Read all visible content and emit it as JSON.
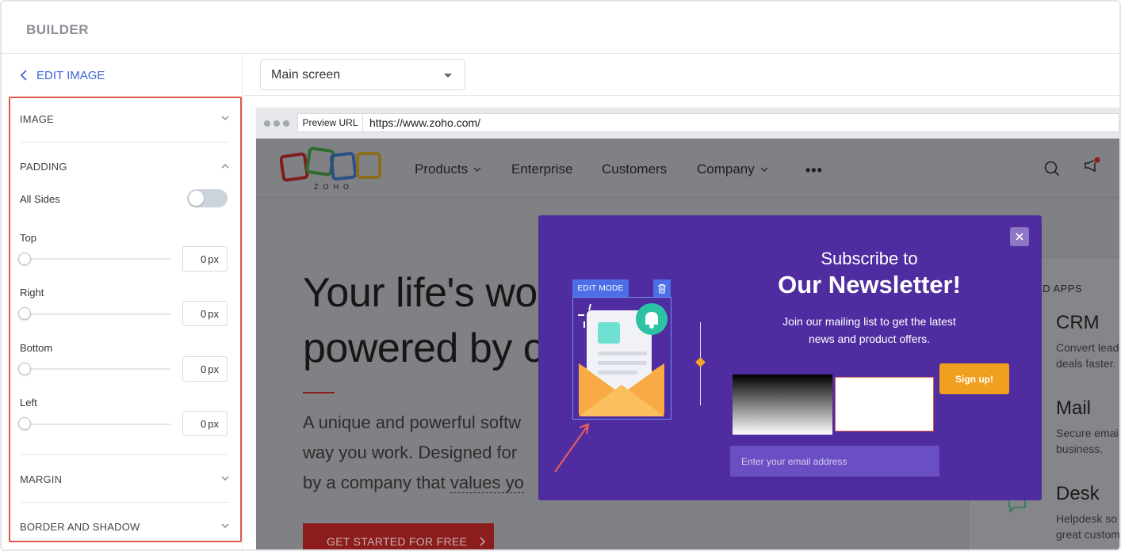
{
  "header": {
    "title": "BUILDER"
  },
  "sidebar": {
    "back_label": "EDIT IMAGE",
    "sections": {
      "image": "IMAGE",
      "padding": "PADDING",
      "margin": "MARGIN",
      "border_shadow": "BORDER AND SHADOW"
    },
    "padding": {
      "all_sides_label": "All Sides",
      "all_sides_on": false,
      "fields": [
        {
          "label": "Top",
          "value": "0",
          "unit": "px"
        },
        {
          "label": "Right",
          "value": "0",
          "unit": "px"
        },
        {
          "label": "Bottom",
          "value": "0",
          "unit": "px"
        },
        {
          "label": "Left",
          "value": "0",
          "unit": "px"
        }
      ]
    }
  },
  "main": {
    "screen_select": "Main screen",
    "preview": {
      "label": "Preview URL",
      "url": "https://www.zoho.com/"
    }
  },
  "site": {
    "logo_text": "ZOHO",
    "nav": [
      "Products",
      "Enterprise",
      "Customers",
      "Company",
      "•••"
    ],
    "hero_line1": "Your life's wo",
    "hero_line2": "powered by c",
    "sub_line1": "A unique and powerful softw",
    "sub_line2": "way you work. Designed for",
    "sub_line3_a": "by a company that ",
    "sub_line3_b": "values yo",
    "cta": "GET STARTED FOR FREE",
    "apps_heading": "ED APPS",
    "apps": [
      {
        "name": "CRM",
        "desc1": "Convert lead",
        "desc2": "deals faster."
      },
      {
        "name": "Mail",
        "desc1": "Secure emai",
        "desc2": "business."
      },
      {
        "name": "Desk",
        "desc1": "Helpdesk so",
        "desc2": "great custom"
      }
    ]
  },
  "popup": {
    "edit_mode": "EDIT MODE",
    "title_line1": "Subscribe to",
    "title_line2": "Our Newsletter!",
    "desc_line1": "Join our mailing list to get the latest",
    "desc_line2": "news and product offers.",
    "signup_label": "Sign up!",
    "email_placeholder": "Enter your email address"
  },
  "colors": {
    "accent_blue": "#3d63d8",
    "highlight_red": "#e2574c",
    "popup_purple": "#4f2da0",
    "signup_orange": "#f0a01e",
    "cta_red": "#8c1d1d"
  }
}
